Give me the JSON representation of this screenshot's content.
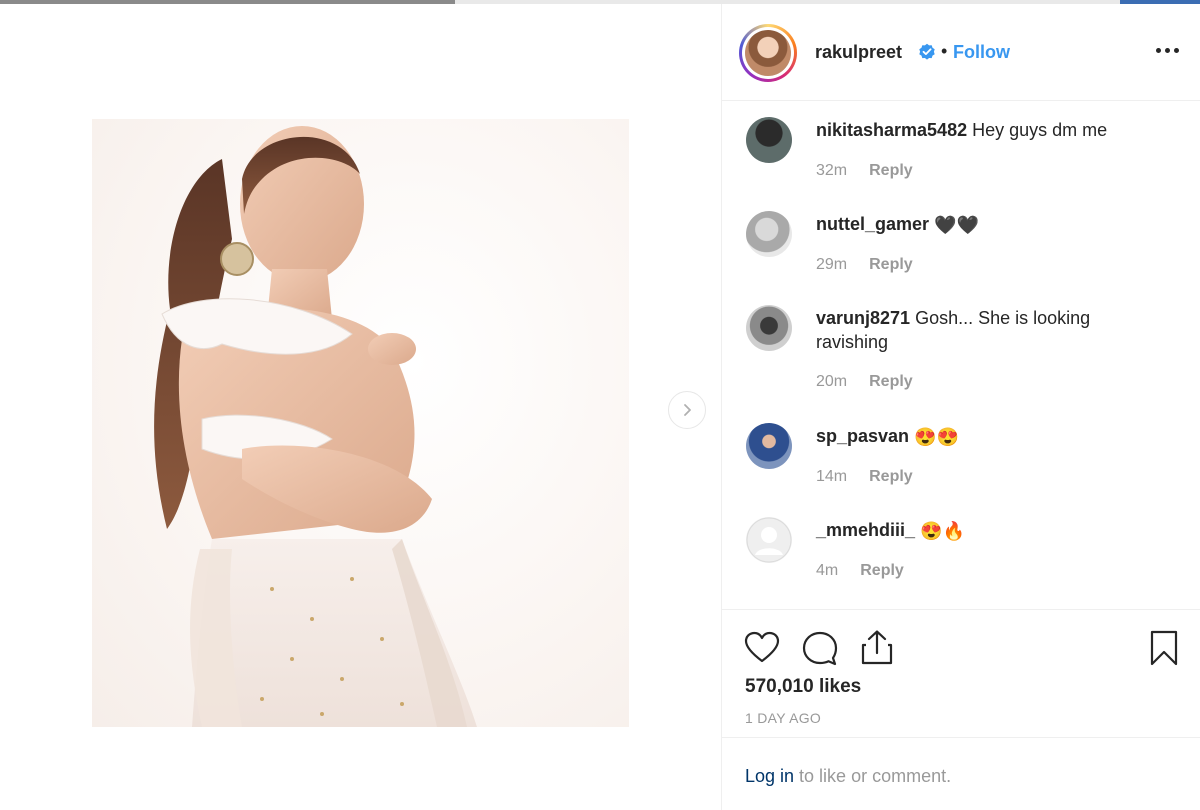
{
  "post": {
    "username": "rakulpreet",
    "separator": "•",
    "follow_label": "Follow"
  },
  "comments": [
    {
      "user": "nikitasharma5482",
      "text": "Hey guys dm me",
      "time": "32m",
      "reply_label": "Reply"
    },
    {
      "user": "nuttel_gamer",
      "text": "🖤🖤",
      "time": "29m",
      "reply_label": "Reply"
    },
    {
      "user": "varunj8271",
      "text": "Gosh... She is looking ravishing",
      "time": "20m",
      "reply_label": "Reply"
    },
    {
      "user": "sp_pasvan",
      "text": "😍😍",
      "time": "14m",
      "reply_label": "Reply"
    },
    {
      "user": "_mmehdiii_",
      "text": "😍🔥",
      "time": "4m",
      "reply_label": "Reply"
    }
  ],
  "stats": {
    "likes": "570,010 likes",
    "time_ago": "1 DAY AGO"
  },
  "login": {
    "link": "Log in",
    "rest": " to like or comment."
  },
  "icons": {
    "like": "heart-icon",
    "comment": "comment-icon",
    "share": "share-icon",
    "save": "bookmark-icon",
    "next": "chevron-right-icon",
    "more": "more-options-icon",
    "verified": "verified-badge-icon"
  },
  "colors": {
    "accent": "#3897f0",
    "muted": "#999999",
    "text": "#262626",
    "login_link": "#003569"
  }
}
